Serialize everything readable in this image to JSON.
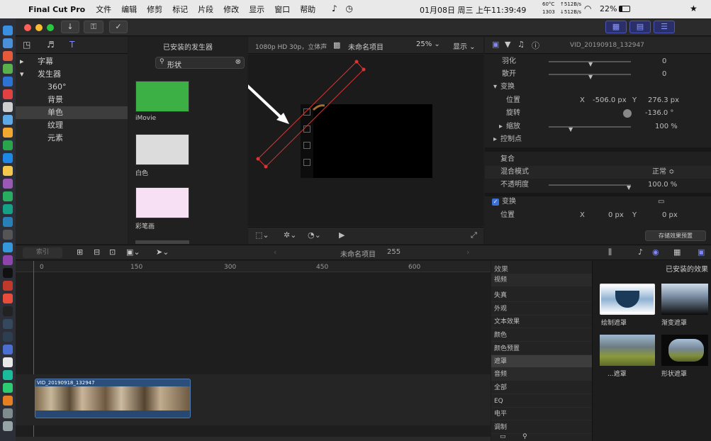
{
  "menubar": {
    "app": "Final Cut Pro",
    "items": [
      "文件",
      "编辑",
      "修剪",
      "标记",
      "片段",
      "修改",
      "显示",
      "窗口",
      "帮助"
    ],
    "datetime": "01月08日 周三 上午11:39:49",
    "net_up": "↑512B/s",
    "net_down": "↓512B/s",
    "temp": "60°C",
    "rpm": "1303",
    "battery": "22%"
  },
  "browser": {
    "header": "已安装的发生器",
    "search": "形状",
    "sidebar": [
      {
        "label": "字幕",
        "kind": "top"
      },
      {
        "label": "发生器",
        "kind": "top"
      },
      {
        "label": "360°",
        "kind": "sub"
      },
      {
        "label": "背景",
        "kind": "sub"
      },
      {
        "label": "单色",
        "kind": "sub"
      },
      {
        "label": "纹理",
        "kind": "sub"
      },
      {
        "label": "元素",
        "kind": "sub"
      }
    ],
    "items": [
      {
        "label": "iMovie",
        "color": "#3cb044"
      },
      {
        "label": "白色",
        "color": "#dcdcdc"
      },
      {
        "label": "彩笔画",
        "color": "#f8e0f4"
      }
    ]
  },
  "viewer": {
    "format": "1080p HD 30p，立体声",
    "project": "未命名项目",
    "zoom": "25%",
    "display": "显示"
  },
  "inspector": {
    "clip": "VID_20190918_132947",
    "rows": {
      "feather": "羽化",
      "feather_val": "0",
      "spread": "散开",
      "spread_val": "0",
      "transform": "变换",
      "position": "位置",
      "pos_x_label": "X",
      "pos_x": "-506.0 px",
      "pos_y_label": "Y",
      "pos_y": "276.3 px",
      "rotation": "旋转",
      "rotation_val": "-136.0 °",
      "scale": "缩放",
      "scale_val": "100 %",
      "control_points": "控制点",
      "composite": "复合",
      "blend_mode": "混合模式",
      "blend_val": "正常 ≎",
      "opacity": "不透明度",
      "opacity_val": "100.0 %",
      "transform2": "变换",
      "pos2": "位置",
      "pos2_x_label": "X",
      "pos2_x": "0 px",
      "pos2_y_label": "Y",
      "pos2_y": "0 px"
    },
    "save_button": "存储效果预置"
  },
  "timeline": {
    "index": "索引",
    "project": "未命名项目",
    "duration": "255",
    "ticks": [
      "0",
      "150",
      "300",
      "450",
      "600"
    ],
    "clip": "VID_20190918_132947"
  },
  "effects": {
    "header": "效果",
    "installed": "已安装的效果",
    "categories": [
      "视频",
      "失真",
      "外观",
      "文本效果",
      "颜色",
      "颜色预置",
      "遮罩",
      "音频",
      "全部",
      "EQ",
      "电平",
      "调制"
    ],
    "selected": "遮罩",
    "thumbs": [
      {
        "label": "绘制遮罩"
      },
      {
        "label": "渐变遮罩"
      },
      {
        "label": "...遮罩"
      },
      {
        "label": "形状遮罩"
      }
    ]
  }
}
